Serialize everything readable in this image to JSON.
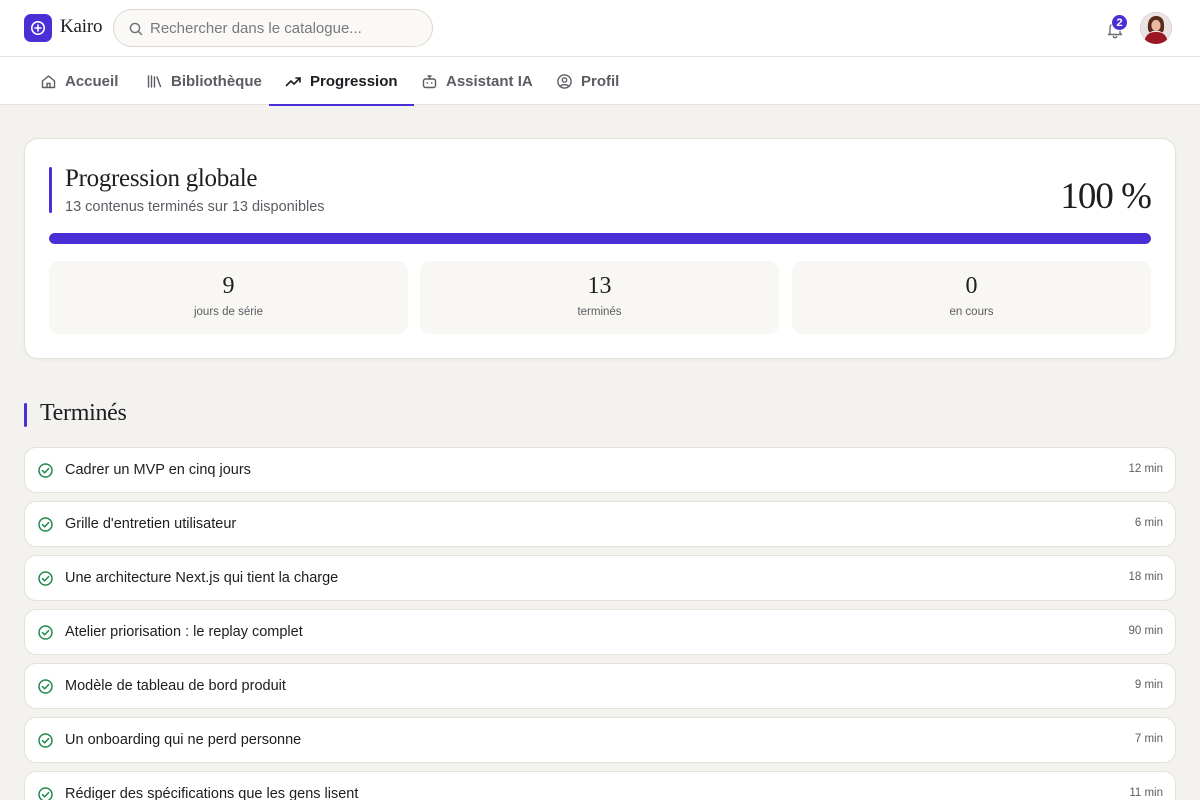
{
  "app": {
    "name": "Kairo",
    "brand_color": "#4b2fd6"
  },
  "search": {
    "placeholder": "Rechercher dans le catalogue...",
    "value": ""
  },
  "notifications": {
    "count": "2"
  },
  "nav": {
    "tabs": [
      {
        "label": "Accueil",
        "icon": "home-icon"
      },
      {
        "label": "Bibliothèque",
        "icon": "library-icon"
      },
      {
        "label": "Progression",
        "icon": "trending-up-icon",
        "active": true
      },
      {
        "label": "Assistant IA",
        "icon": "robot-icon"
      },
      {
        "label": "Profil",
        "icon": "user-circle-icon"
      }
    ]
  },
  "progress": {
    "title": "Progression globale",
    "subtitle": "13 contenus terminés sur 13 disponibles",
    "percent_label": "100 %",
    "percent_value": 100,
    "stats": [
      {
        "value": "9",
        "label": "jours de série"
      },
      {
        "value": "13",
        "label": "terminés"
      },
      {
        "value": "0",
        "label": "en cours"
      }
    ]
  },
  "completed": {
    "heading": "Terminés",
    "items": [
      {
        "title": "Cadrer un MVP en cinq jours",
        "duration": "12 min"
      },
      {
        "title": "Grille d'entretien utilisateur",
        "duration": "6 min"
      },
      {
        "title": "Une architecture Next.js qui tient la charge",
        "duration": "18 min"
      },
      {
        "title": "Atelier priorisation : le replay complet",
        "duration": "90 min"
      },
      {
        "title": "Modèle de tableau de bord produit",
        "duration": "9 min"
      },
      {
        "title": "Un onboarding qui ne perd personne",
        "duration": "7 min"
      },
      {
        "title": "Rédiger des spécifications que les gens lisent",
        "duration": "11 min"
      }
    ]
  }
}
